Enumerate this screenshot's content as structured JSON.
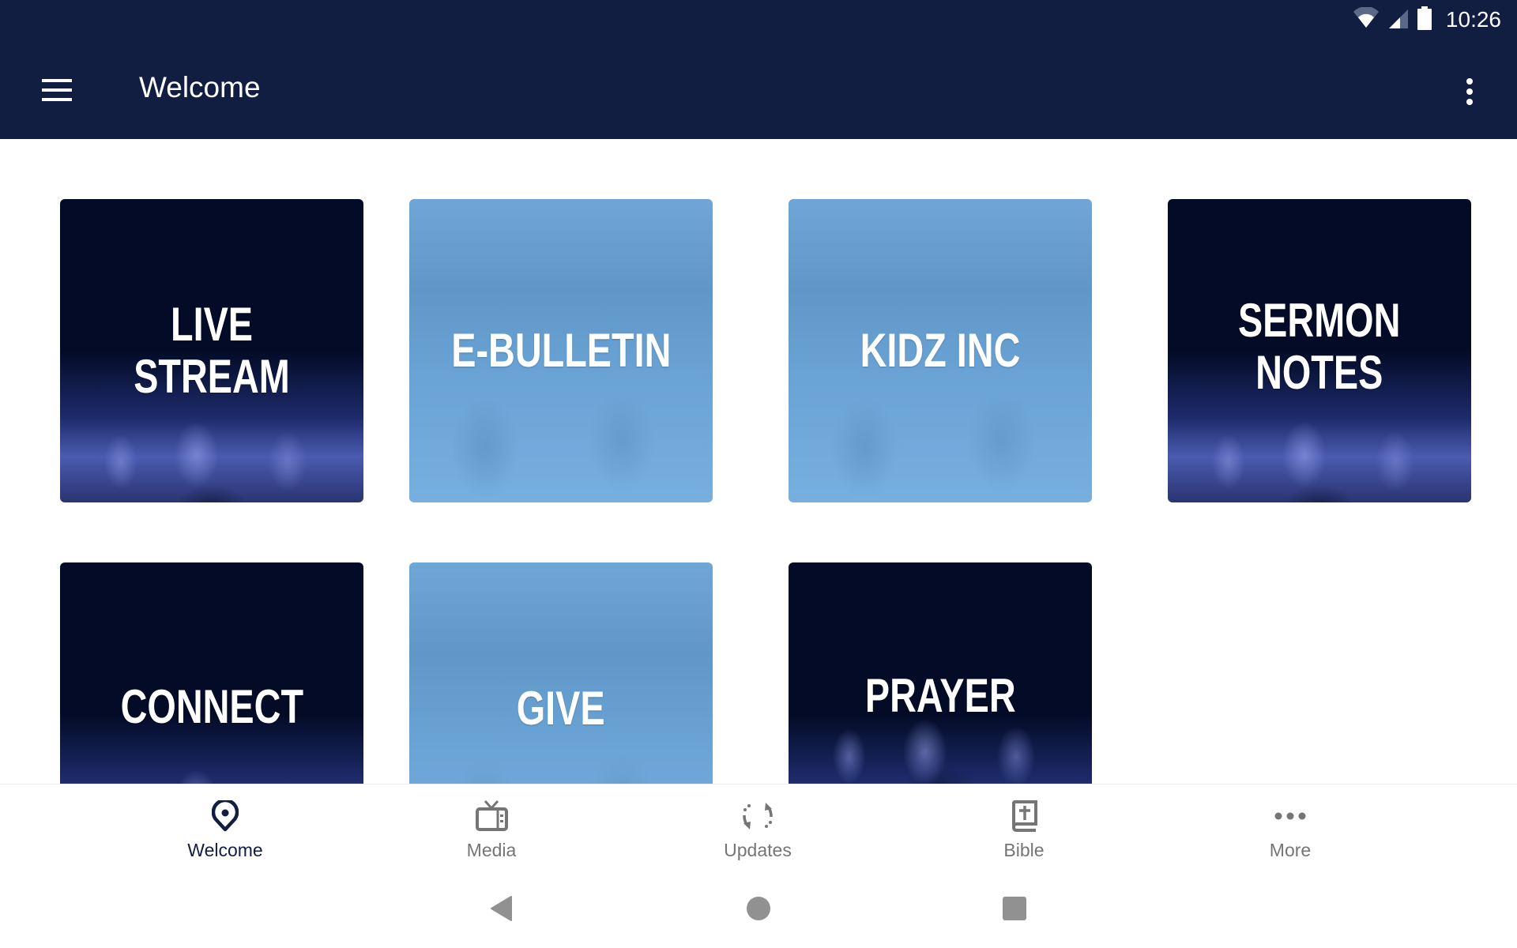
{
  "status_bar": {
    "time": "10:26",
    "icons": [
      "wifi-icon",
      "cell-signal-icon",
      "battery-icon"
    ]
  },
  "app_bar": {
    "title": "Welcome",
    "menu_icon": "hamburger-menu-icon",
    "overflow_icon": "more-vert-icon"
  },
  "tiles": [
    {
      "label": "LIVE STREAM",
      "style": "dark"
    },
    {
      "label": "E-BULLETIN",
      "style": "light"
    },
    {
      "label": "KIDZ INC",
      "style": "light"
    },
    {
      "label": "SERMON\nNOTES",
      "style": "dark"
    },
    {
      "label": "CONNECT",
      "style": "dark"
    },
    {
      "label": "GIVE",
      "style": "light"
    },
    {
      "label": "PRAYER",
      "style": "dark"
    }
  ],
  "bottom_nav": {
    "items": [
      {
        "label": "Welcome",
        "icon": "location-pin-icon",
        "active": true
      },
      {
        "label": "Media",
        "icon": "tv-icon",
        "active": false
      },
      {
        "label": "Updates",
        "icon": "sync-icon",
        "active": false
      },
      {
        "label": "Bible",
        "icon": "bible-icon",
        "active": false
      },
      {
        "label": "More",
        "icon": "more-horiz-icon",
        "active": false
      }
    ]
  },
  "system_nav": {
    "buttons": [
      "back",
      "home",
      "recents"
    ]
  },
  "colors": {
    "primary": "#111e42",
    "tile_dark": "#030b26",
    "tile_light": "#6aa3d5",
    "nav_inactive": "#757575"
  }
}
